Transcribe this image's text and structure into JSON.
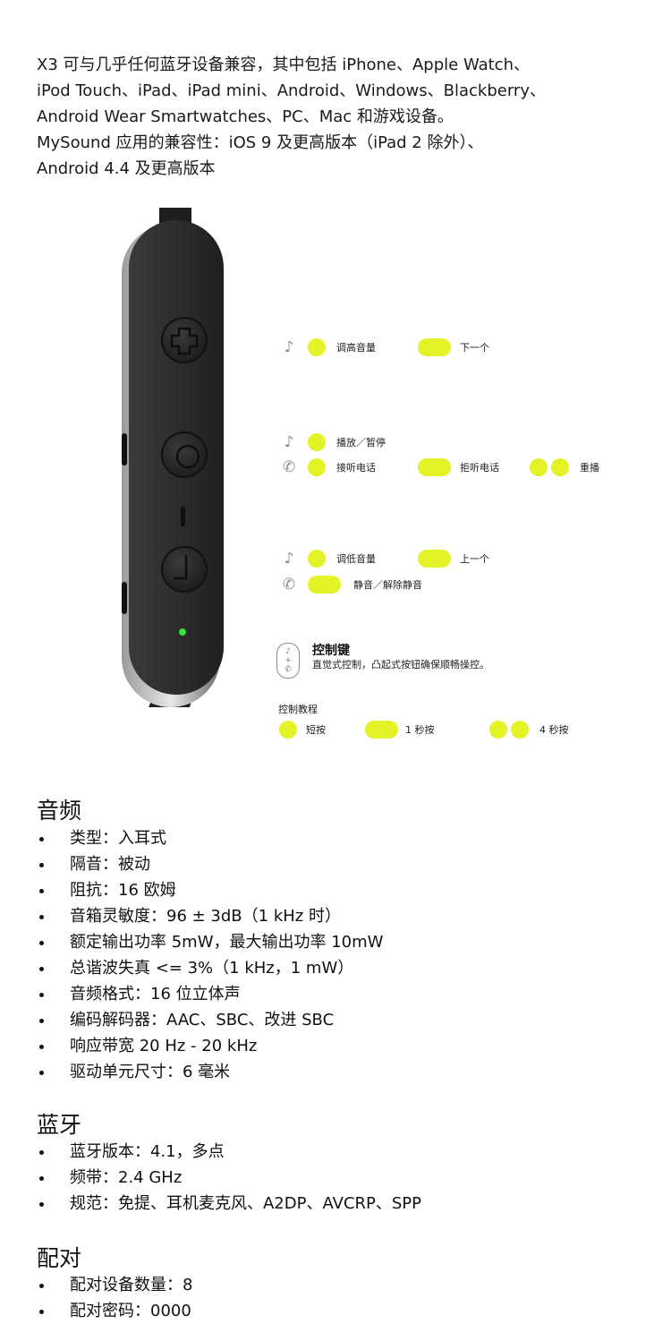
{
  "intro": {
    "lines": [
      "X3 可与几乎任何蓝牙设备兼容，其中包括 iPhone、Apple Watch、",
      "iPod Touch、iPad、iPad mini、Android、Windows、Blackberry、",
      "Android Wear Smartwatches、PC、Mac 和游戏设备。",
      "MySound 应用的兼容性：iOS 9 及更高版本（iPad 2 除外）、",
      "Android 4.4 及更高版本"
    ]
  },
  "controls": {
    "volume_up": "调高音量",
    "next": "下一个",
    "play_pause": "播放／暂停",
    "answer": "接听电话",
    "reject": "拒听电话",
    "redial": "重播",
    "volume_down": "调低音量",
    "previous": "上一个",
    "mute": "静音／解除静音"
  },
  "control_keys": {
    "title": "控制键",
    "description": "直觉式控制，凸起式按钮确保顺畅操控。"
  },
  "tutorial": {
    "title": "控制教程",
    "short_press": "短按",
    "one_sec_press": "1 秒按",
    "four_sec_press": "4 秒按"
  },
  "colors": {
    "accent": "#e4f228",
    "led": "#35e03a",
    "remote_body": "#2b2b2b"
  },
  "sections": {
    "audio": {
      "title": "音频",
      "items": [
        "类型：入耳式",
        "隔音：被动",
        "阻抗：16 欧姆",
        "音箱灵敏度：96 ± 3dB（1 kHz 时）",
        "额定输出功率 5mW，最大输出功率 10mW",
        "总谐波失真 <= 3%（1 kHz，1 mW）",
        "音频格式：16 位立体声",
        "编码解码器：AAC、SBC、改进 SBC",
        "响应带宽 20 Hz - 20 kHz",
        "驱动单元尺寸：6 毫米"
      ]
    },
    "bluetooth": {
      "title": "蓝牙",
      "items": [
        "蓝牙版本：4.1，多点",
        "频带：2.4 GHz",
        "规范：免提、耳机麦克风、A2DP、AVCRP、SPP"
      ]
    },
    "pairing": {
      "title": "配对",
      "items": [
        "配对设备数量：8",
        "配对密码：0000"
      ]
    }
  }
}
